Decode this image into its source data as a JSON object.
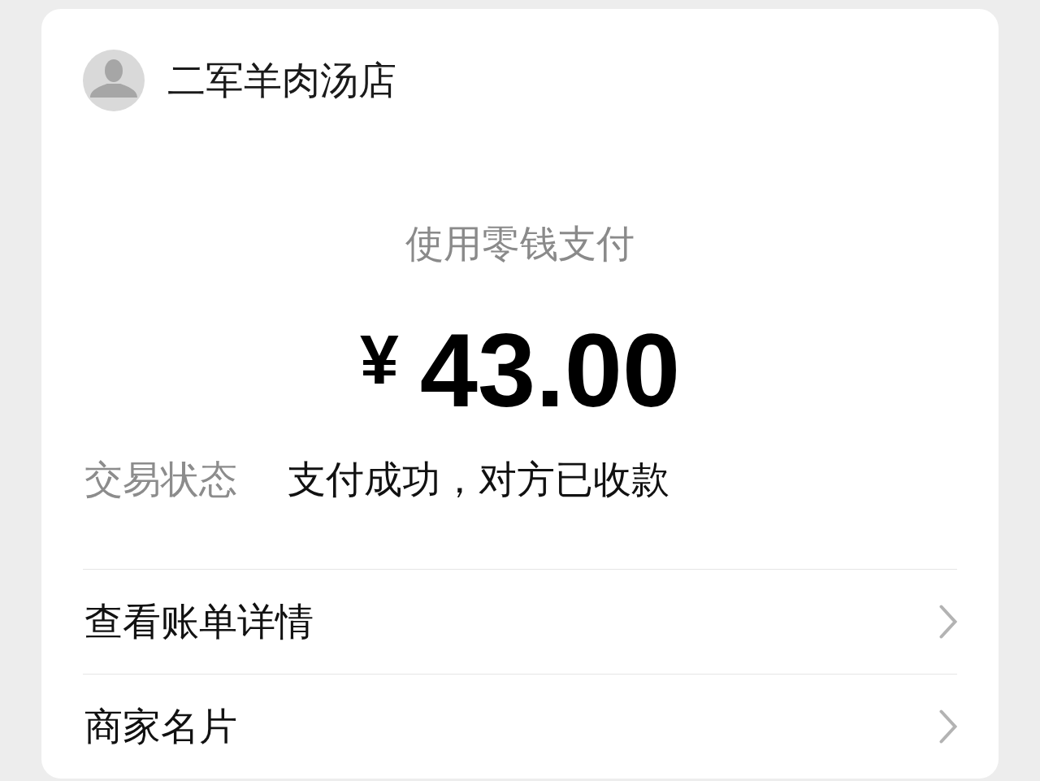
{
  "merchant": {
    "name": "二军羊肉汤店"
  },
  "payment_method": "使用零钱支付",
  "amount": {
    "currency": "¥",
    "value": "43.00"
  },
  "status": {
    "label": "交易状态",
    "value": "支付成功，对方已收款"
  },
  "links": [
    {
      "label": "查看账单详情"
    },
    {
      "label": "商家名片"
    }
  ]
}
